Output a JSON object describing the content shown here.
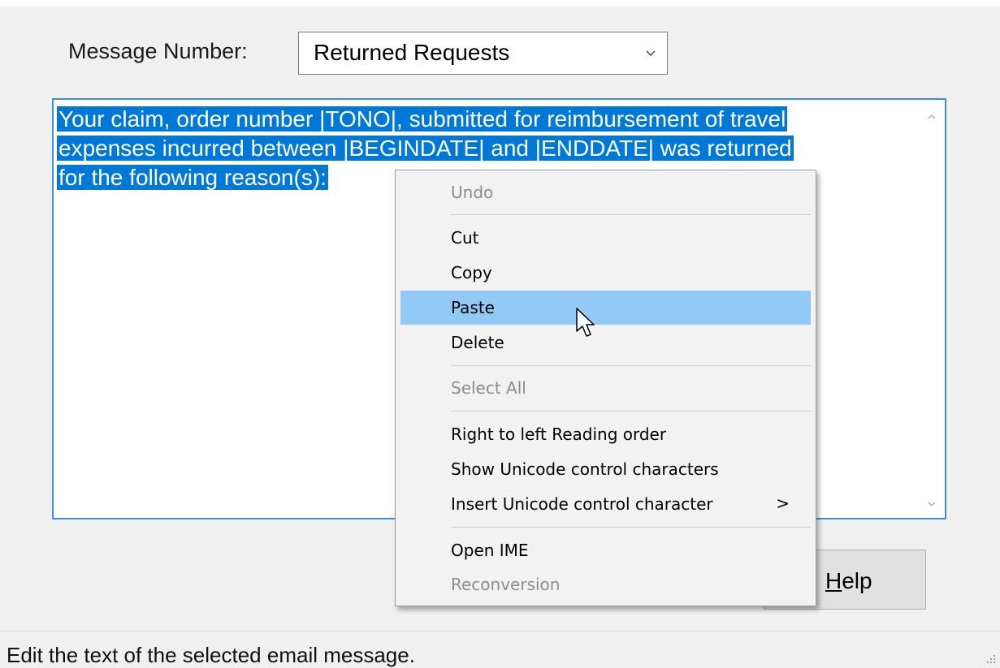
{
  "form": {
    "message_number_label": "Message Number:",
    "message_number_value": "Returned Requests"
  },
  "editor": {
    "lines": [
      "Your claim, order number |TONO|, submitted for reimbursement of travel",
      "expenses incurred between |BEGINDATE| and |ENDDATE| was returned",
      "for the following reason(s):"
    ]
  },
  "context_menu": {
    "undo": "Undo",
    "cut": "Cut",
    "copy": "Copy",
    "paste": "Paste",
    "delete": "Delete",
    "select_all": "Select All",
    "rtl": "Right to left Reading order",
    "show_unicode": "Show Unicode control characters",
    "insert_unicode": "Insert Unicode control character",
    "submenu_arrow": ">",
    "open_ime": "Open IME",
    "reconversion": "Reconversion"
  },
  "buttons": {
    "help_prefix": "H",
    "help_rest": "elp"
  },
  "statusbar": {
    "text": "Edit the text of the selected email message."
  },
  "colors": {
    "selection": "#0078d7",
    "menu_hover": "#91c9f7",
    "editor_border": "#3c8fd9"
  }
}
